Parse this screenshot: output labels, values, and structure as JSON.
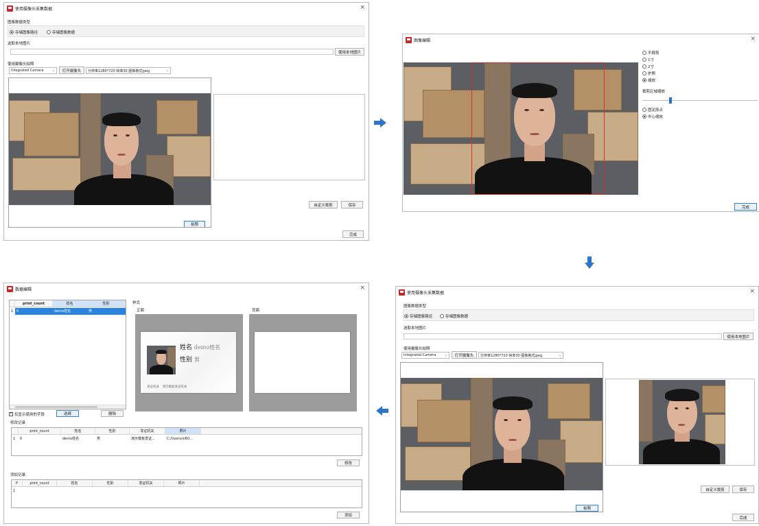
{
  "colors": {
    "accent": "#2a84df",
    "crop_frame": "#d32f2f",
    "arrow": "#2e75c8"
  },
  "window1": {
    "title": "使用摄像头采集数据",
    "mode_label": "图像数据类型",
    "mode_options": [
      "存储图像路径",
      "存储图像数据"
    ],
    "mode_selected": 0,
    "local_label": "选取本地图片",
    "local_button": "使用本地图片",
    "camera_label": "使用摄像头拍照",
    "camera_select": "Integrated Camera",
    "open_camera_button": "打开摄像头",
    "resolution_select": "分辨率1280*720 帧率30 图像格式jpeg",
    "capture_button": "拍照",
    "custom_crop_button": "自定义裁剪",
    "save_button": "保存",
    "done_button": "完成"
  },
  "window2": {
    "title": "图像编辑",
    "crop_options": [
      "不裁剪",
      "1寸",
      "2寸",
      "护照",
      "缩放"
    ],
    "crop_selected": 4,
    "scale_label": "裁剪区域缩放",
    "scale_value": 0.15,
    "anchor_options": [
      "固定原点",
      "中心缩放"
    ],
    "anchor_selected": 1,
    "done_button": "完成"
  },
  "window3": {
    "title": "使用摄像头采集数据",
    "mode_label": "图像数据类型",
    "mode_options": [
      "存储图像路径",
      "存储图像数据"
    ],
    "mode_selected": 0,
    "local_label": "选取本地图片",
    "local_button": "使用本地图片",
    "camera_label": "使用摄像头拍照",
    "camera_select": "Integrated Camera",
    "open_camera_button": "打开摄像头",
    "resolution_select": "分辨率1280*720 帧率30 图像格式jpeg",
    "capture_button": "拍照",
    "custom_crop_button": "自定义裁剪",
    "save_button": "保存",
    "done_button": "完成"
  },
  "window4": {
    "title": "数据编辑",
    "grid": {
      "columns": [
        "print_count",
        "姓名",
        "性别"
      ],
      "rows": [
        [
          "1",
          "0",
          "demo姓名",
          "男"
        ]
      ]
    },
    "checkbox_label": "仅显示使用的字段",
    "checkbox_checked": true,
    "select_button": "选择",
    "delete_button": "删除",
    "template_label": "样式",
    "front_label": "正面",
    "back_label": "背面",
    "card": {
      "name_label": "姓名",
      "name_value": "demo姓名",
      "gender_label": "性别",
      "gender_value": "男",
      "footer_left": "发证机关",
      "footer_right": "演示模板发证机关"
    },
    "edit_label": "修改记录",
    "edit_table": {
      "columns": [
        "print_count",
        "姓名",
        "性别",
        "发证机关",
        "照片"
      ],
      "rows": [
        [
          "1",
          "0",
          "demo姓名",
          "男",
          "演示模板发证...",
          "C:/Users/xl60..."
        ]
      ]
    },
    "modify_button": "修改",
    "add_label": "添加记录",
    "add_table": {
      "columns": [
        "P",
        "print_count",
        "姓名",
        "性别",
        "发证机关",
        "照片"
      ],
      "rows": [
        [
          "1"
        ]
      ]
    },
    "add_button": "添加"
  }
}
